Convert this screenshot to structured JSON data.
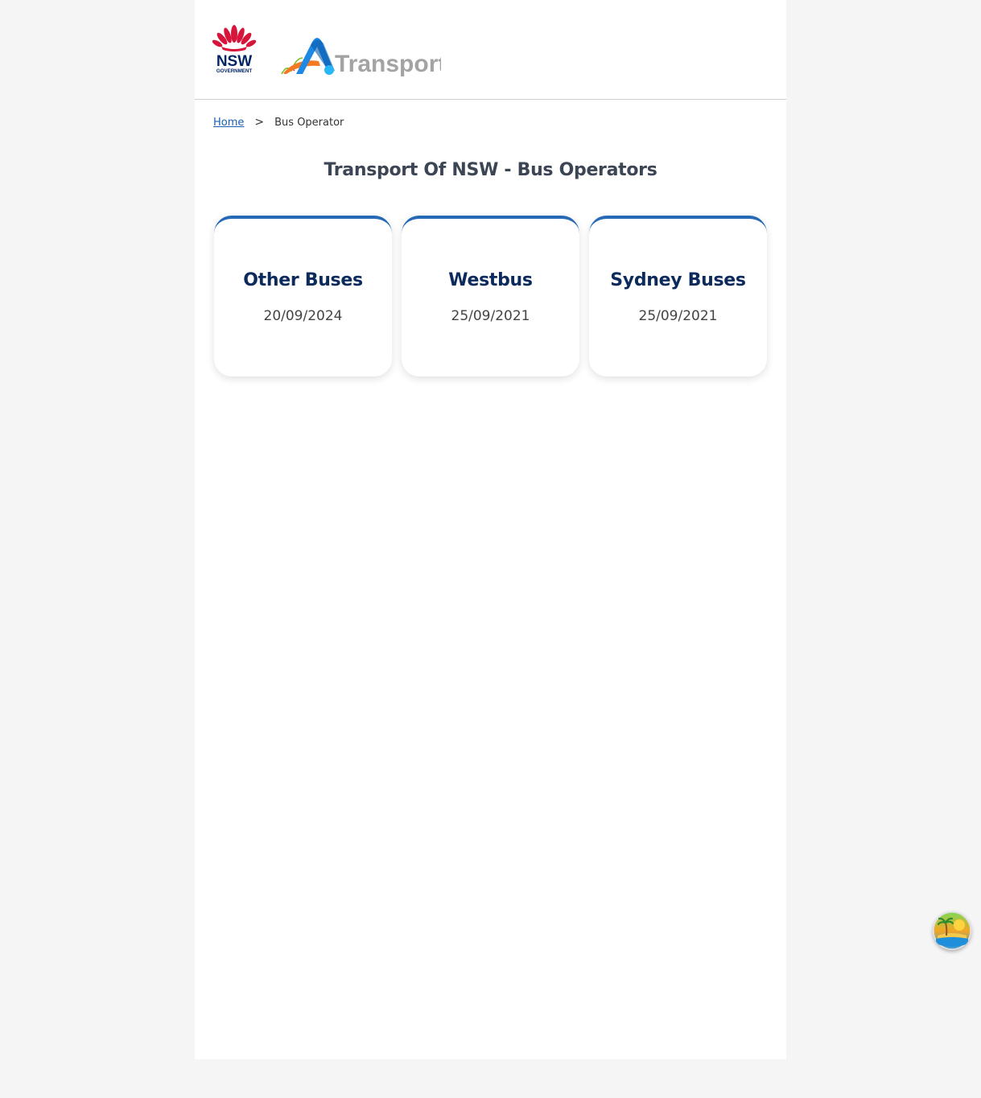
{
  "header": {
    "nsw_logo_text": "NSW",
    "nsw_logo_sub": "GOVERNMENT",
    "transport_logo_text": "Transport"
  },
  "breadcrumb": {
    "home": "Home",
    "separator": ">",
    "current": "Bus Operator"
  },
  "page_title": "Transport Of NSW - Bus Operators",
  "operators": [
    {
      "name": "Other Buses",
      "date": "20/09/2024"
    },
    {
      "name": "Westbus",
      "date": "25/09/2021"
    },
    {
      "name": "Sydney Buses",
      "date": "25/09/2021"
    }
  ],
  "colors": {
    "accent": "#2669b7",
    "card_title": "#0d2a5c",
    "page_title": "#3b4554"
  },
  "fab_icon": "island-sunset-icon"
}
